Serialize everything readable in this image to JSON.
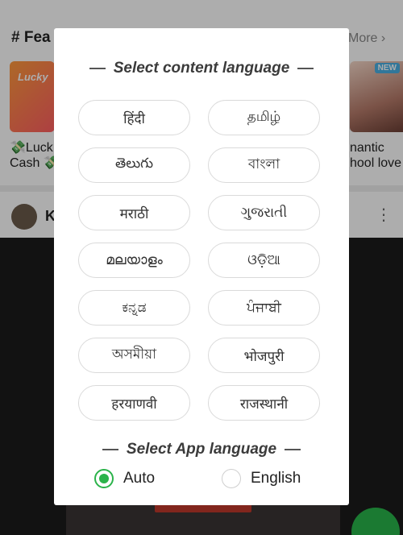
{
  "background": {
    "section_heading": "# Fea",
    "more_link": "More ›",
    "left_card_label": "Lucky",
    "left_caption_line1": "💸Luck",
    "left_caption_line2": "Cash 💸",
    "right_card_badge": "NEW",
    "right_caption_line1": "nantic",
    "right_caption_line2": "hool love",
    "author_initial": "K",
    "kebab": "⋮"
  },
  "dialog": {
    "content_language_title": "Select content language",
    "languages": [
      "हिंदी",
      "தமிழ்",
      "తెలుగు",
      "বাংলা",
      "मराठी",
      "ગુજરાતી",
      "മലയാളം",
      "ଓଡ଼ିଆ",
      "ಕನ್ನಡ",
      "ਪੰਜਾਬੀ",
      "অসমীয়া",
      "भोजपुरी",
      "हरयाणवी",
      "राजस्थानी"
    ],
    "app_language_title": "Select App language",
    "app_language_options": [
      {
        "label": "Auto",
        "selected": true
      },
      {
        "label": "English",
        "selected": false
      }
    ],
    "accent_color": "#2bb34a"
  }
}
